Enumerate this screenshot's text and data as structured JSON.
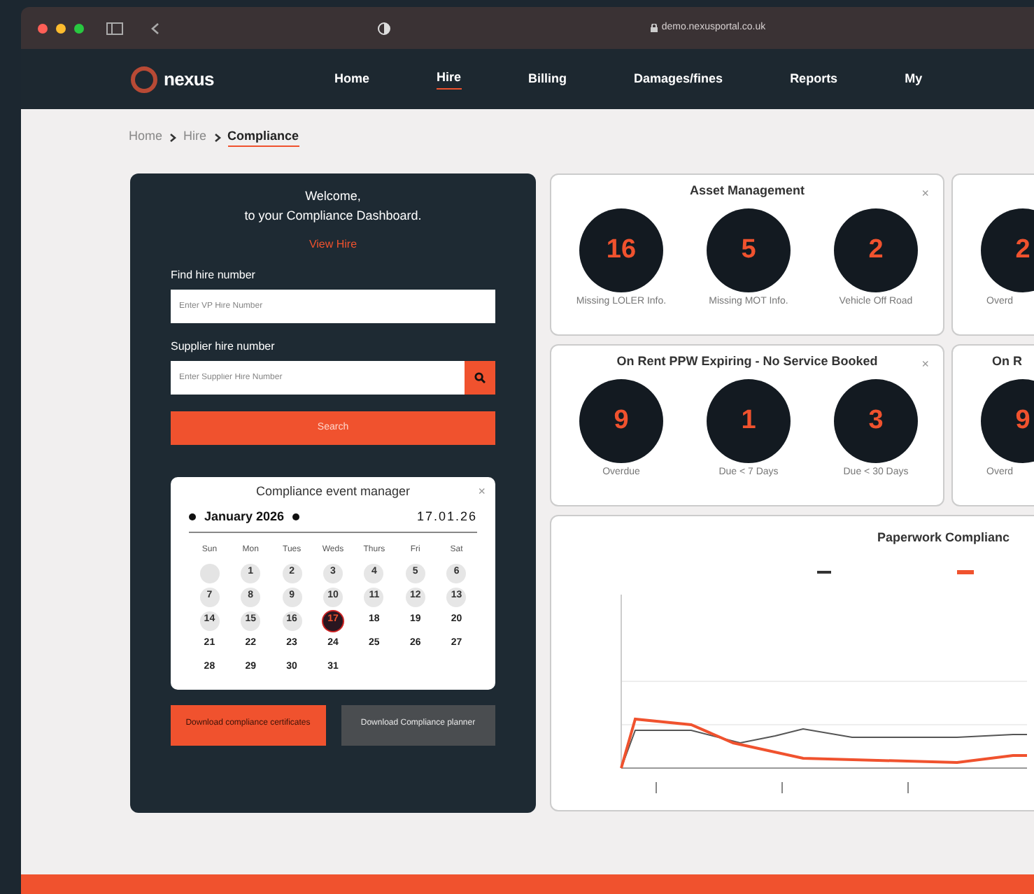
{
  "browser": {
    "url": "demo.nexusportal.co.uk"
  },
  "logo": {
    "name": "nexus"
  },
  "nav": [
    {
      "label": "Home",
      "selected": false
    },
    {
      "label": "Hire",
      "selected": true
    },
    {
      "label": "Billing",
      "selected": false
    },
    {
      "label": "Damages/fines",
      "selected": false
    },
    {
      "label": "Reports",
      "selected": false
    },
    {
      "label": "My",
      "selected": false
    }
  ],
  "breadcrumb": [
    {
      "label": "Home",
      "current": false
    },
    {
      "label": "Hire",
      "current": false
    },
    {
      "label": "Compliance",
      "current": true
    }
  ],
  "search_panel": {
    "welcome": "Welcome,",
    "subtitle": "to your Compliance Dashboard.",
    "link": "View Hire",
    "fields": [
      {
        "kind": "plain",
        "label": "Find hire number",
        "placeholder": "Enter VP Hire Number"
      },
      {
        "kind": "search",
        "label": "Supplier hire number",
        "placeholder": "Enter Supplier Hire Number"
      }
    ],
    "button": "Search"
  },
  "calendar": {
    "title": "Compliance event manager",
    "close": "×",
    "month": "January 2026",
    "date": "17.01.26",
    "weekdays": [
      "Sun",
      "Mon",
      "Tues",
      "Weds",
      "Thurs",
      "Fri",
      "Sat"
    ],
    "days": [
      {
        "kind": "blank"
      },
      {
        "kind": "day",
        "label": "1",
        "past": true,
        "selected": false
      },
      {
        "kind": "day",
        "label": "2",
        "past": true,
        "selected": false
      },
      {
        "kind": "day",
        "label": "3",
        "past": true,
        "selected": false
      },
      {
        "kind": "day",
        "label": "4",
        "past": true,
        "selected": false
      },
      {
        "kind": "day",
        "label": "5",
        "past": true,
        "selected": false
      },
      {
        "kind": "day",
        "label": "6",
        "past": true,
        "selected": false
      },
      {
        "kind": "day",
        "label": "7",
        "past": true,
        "selected": false
      },
      {
        "kind": "day",
        "label": "8",
        "past": true,
        "selected": false
      },
      {
        "kind": "day",
        "label": "9",
        "past": true,
        "selected": false
      },
      {
        "kind": "day",
        "label": "10",
        "past": true,
        "selected": false
      },
      {
        "kind": "day",
        "label": "11",
        "past": true,
        "selected": false
      },
      {
        "kind": "day",
        "label": "12",
        "past": true,
        "selected": false
      },
      {
        "kind": "day",
        "label": "13",
        "past": true,
        "selected": false
      },
      {
        "kind": "day",
        "label": "14",
        "past": true,
        "selected": false
      },
      {
        "kind": "day",
        "label": "15",
        "past": true,
        "selected": false
      },
      {
        "kind": "day",
        "label": "16",
        "past": true,
        "selected": false
      },
      {
        "kind": "day",
        "label": "17",
        "past": false,
        "selected": true
      },
      {
        "kind": "day",
        "label": "18",
        "past": false,
        "selected": false
      },
      {
        "kind": "day",
        "label": "19",
        "past": false,
        "selected": false
      },
      {
        "kind": "day",
        "label": "20",
        "past": false,
        "selected": false
      },
      {
        "kind": "day",
        "label": "21",
        "past": false,
        "selected": false
      },
      {
        "kind": "day",
        "label": "22",
        "past": false,
        "selected": false
      },
      {
        "kind": "day",
        "label": "23",
        "past": false,
        "selected": false
      },
      {
        "kind": "day",
        "label": "24",
        "past": false,
        "selected": false
      },
      {
        "kind": "day",
        "label": "25",
        "past": false,
        "selected": false
      },
      {
        "kind": "day",
        "label": "26",
        "past": false,
        "selected": false
      },
      {
        "kind": "day",
        "label": "27",
        "past": false,
        "selected": false
      },
      {
        "kind": "day",
        "label": "28",
        "past": false,
        "selected": false
      },
      {
        "kind": "day",
        "label": "29",
        "past": false,
        "selected": false
      },
      {
        "kind": "day",
        "label": "30",
        "past": false,
        "selected": false
      },
      {
        "kind": "day",
        "label": "31",
        "past": false,
        "selected": false
      }
    ]
  },
  "panel_buttons": [
    {
      "kind": "primary",
      "label": "Download compliance certificates"
    },
    {
      "kind": "secondary",
      "label": "Download Compliance planner"
    }
  ],
  "cards": [
    {
      "kind": "full",
      "title": "Asset Management",
      "close": "×",
      "metrics": [
        {
          "value": "16",
          "label": "Missing LOLER Info."
        },
        {
          "value": "5",
          "label": "Missing MOT Info."
        },
        {
          "value": "2",
          "label": "Vehicle Off Road"
        }
      ]
    },
    {
      "kind": "partial",
      "metrics": [
        {
          "value": "2",
          "label": "Overd"
        }
      ]
    },
    {
      "kind": "full",
      "title": "On Rent PPW Expiring - No Service Booked",
      "close": "×",
      "metrics": [
        {
          "value": "9",
          "label": "Overdue"
        },
        {
          "value": "1",
          "label": "Due < 7 Days"
        },
        {
          "value": "3",
          "label": "Due < 30 Days"
        }
      ]
    },
    {
      "kind": "partial",
      "title": "On R",
      "metrics": [
        {
          "value": "9",
          "label": "Overd"
        }
      ]
    }
  ],
  "chart_card": {
    "title": "Paperwork Complianc"
  }
}
